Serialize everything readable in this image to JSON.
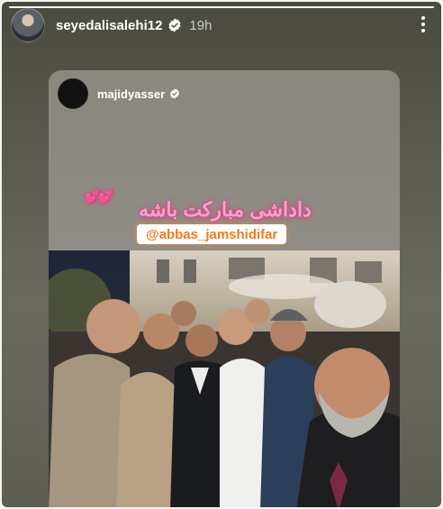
{
  "story": {
    "username": "seyedalisalehi12",
    "time_ago": "19h",
    "verified_icon": "verified-badge-icon",
    "more_icon": "more-vertical-icon",
    "progress": 1.0
  },
  "shared_post": {
    "username": "majidyasser",
    "verified_icon": "verified-badge-icon",
    "caption": "داداشی مبارکت باشه",
    "hearts": "💕💕",
    "mention": "@abbas_jamshidifar"
  },
  "colors": {
    "story_bg": "#55554a",
    "card_bg": "#8f8c85",
    "verified_blue": "#3897f0",
    "caption_glow": "#ff2a80",
    "mention_text": "#f07b1c"
  }
}
